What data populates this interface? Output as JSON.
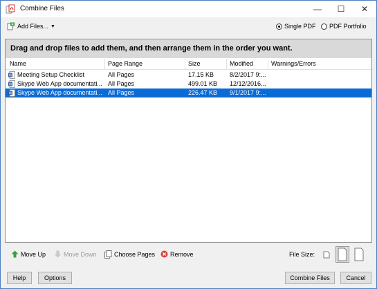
{
  "window": {
    "title": "Combine Files"
  },
  "toolbar": {
    "add_files_label": "Add Files...",
    "single_pdf_label": "Single PDF",
    "pdf_portfolio_label": "PDF Portfolio",
    "selected_mode": "Single PDF"
  },
  "banner": "Drag and drop files to add them, and then arrange them in the order you want.",
  "table": {
    "headers": [
      "Name",
      "Page Range",
      "Size",
      "Modified",
      "Warnings/Errors"
    ],
    "rows": [
      {
        "name": "Meeting Setup Checklist",
        "page_range": "All Pages",
        "size": "17.15 KB",
        "modified": "8/2/2017 9:...",
        "warnings": ""
      },
      {
        "name": "Skype Web App documentati...",
        "page_range": "All Pages",
        "size": "499.01 KB",
        "modified": "12/12/2016...",
        "warnings": ""
      },
      {
        "name": "Skype Web App documentati...",
        "page_range": "All Pages",
        "size": "226.47 KB",
        "modified": "9/1/2017 9:...",
        "warnings": "",
        "selected": true
      }
    ]
  },
  "bottom": {
    "move_up": "Move Up",
    "move_down": "Move Down",
    "choose_pages": "Choose Pages",
    "remove": "Remove",
    "file_size_label": "File Size:"
  },
  "footer": {
    "help": "Help",
    "options": "Options",
    "combine": "Combine Files",
    "cancel": "Cancel"
  },
  "colors": {
    "selection": "#0a6bd6",
    "banner": "#d9d9d9",
    "word_icon": "#2b579a"
  }
}
